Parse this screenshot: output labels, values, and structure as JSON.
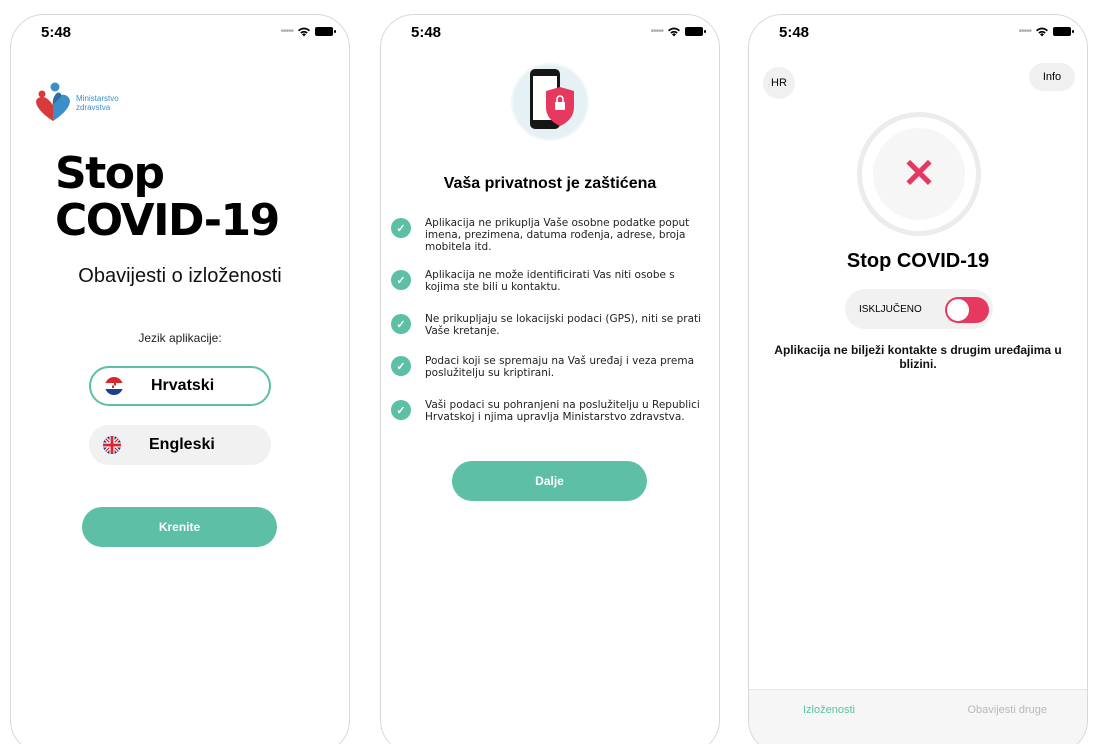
{
  "colors": {
    "accent_teal": "#5cbfa6",
    "alert_red": "#e6395f",
    "logo_blue": "#3b8fc9",
    "logo_red": "#d63a3a"
  },
  "status_bar": {
    "time": "5:48",
    "icons": [
      "signal-dots-icon",
      "wifi-icon",
      "battery-icon"
    ]
  },
  "screen1": {
    "logo": {
      "line1": "Ministarstvo",
      "line2": "zdravstva"
    },
    "title_line1": "Stop",
    "title_line2": "COVID-19",
    "subtitle": "Obavijesti o izloženosti",
    "language_label": "Jezik aplikacije:",
    "languages": [
      {
        "name": "Hrvatski",
        "flag": "croatia-flag-icon",
        "selected": true
      },
      {
        "name": "Engleski",
        "flag": "uk-flag-icon",
        "selected": false
      }
    ],
    "start_button": "Krenite"
  },
  "screen2": {
    "illustration": "phone-shield-lock-icon",
    "title": "Vaša privatnost je zaštićena",
    "items": [
      "Aplikacija ne prikuplja Vaše osobne podatke poput imena, prezimena, datuma rođenja, adrese, broja mobitela itd.",
      "Aplikacija ne može identificirati Vas niti osobe s kojima ste bili u kontaktu.",
      "Ne prikupljaju se lokacijski podaci (GPS), niti se prati Vaše kretanje.",
      "Podaci koji se spremaju na Vaš uređaj i veza prema poslužitelju su kriptirani.",
      "Vaši podaci su pohranjeni na poslužitelju u Republici Hrvatskoj i njima upravlja Ministarstvo zdravstva."
    ],
    "next_button": "Dalje"
  },
  "screen3": {
    "language_pill": "HR",
    "info_button": "Info",
    "status_icon": "close-x-icon",
    "title": "Stop COVID-19",
    "toggle_label": "ISKLJUČENO",
    "toggle_on": false,
    "message": "Aplikacija ne bilježi kontakte s drugim uređajima u blizini.",
    "tabs": [
      {
        "label": "Izloženosti",
        "active": true
      },
      {
        "label": "Obavijesti druge",
        "active": false
      }
    ]
  }
}
